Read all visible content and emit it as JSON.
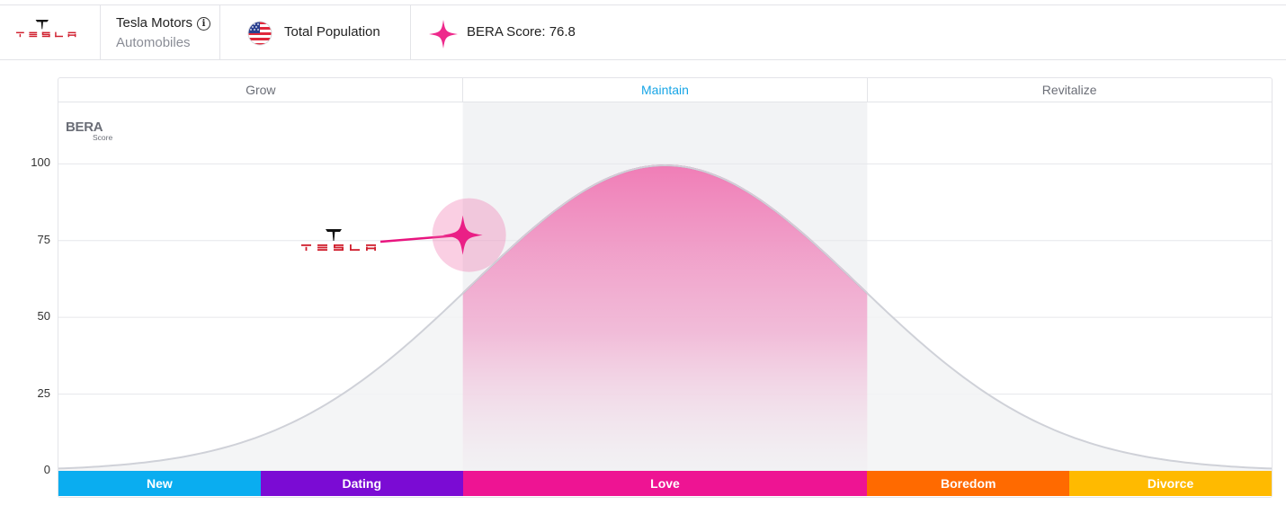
{
  "header": {
    "brand_name": "Tesla Motors",
    "brand_category": "Automobiles",
    "population_label": "Total Population",
    "score_label": "BERA Score: 76.8",
    "logo_word": "TESLA"
  },
  "colors": {
    "accent_pink": "#ee2a8c",
    "active_blue": "#17a5e6",
    "curve_grey": "#cfd1d8",
    "fill_grey": "#f2f3f5"
  },
  "icons": {
    "logo": "tesla-logo-icon",
    "info": "info-icon",
    "flag": "us-flag-icon",
    "score": "sparkle-star-icon"
  },
  "chart_data": {
    "type": "area",
    "title": "",
    "y_label_title": "BERA",
    "y_label_sub": "Score",
    "ylim": [
      0,
      120
    ],
    "yticks": [
      0,
      25,
      50,
      75,
      100
    ],
    "grid": true,
    "phases": [
      {
        "name": "Grow",
        "active": false
      },
      {
        "name": "Maintain",
        "active": true
      },
      {
        "name": "Revitalize",
        "active": false
      }
    ],
    "stages": [
      {
        "name": "New",
        "color": "#0aadf0"
      },
      {
        "name": "Dating",
        "color": "#7b0bd4"
      },
      {
        "name": "Love",
        "color": "#ee1493"
      },
      {
        "name": "Boredom",
        "color": "#ff6a00"
      },
      {
        "name": "Divorce",
        "color": "#ffba00"
      }
    ],
    "curve": {
      "shape": "bell",
      "peak": 99.5,
      "peak_position": 0.5,
      "spread": 0.16
    },
    "highlight_range": [
      0.3333,
      0.6667
    ],
    "marker": {
      "brand": "Tesla",
      "score": 76.8,
      "position": 0.3333
    }
  }
}
